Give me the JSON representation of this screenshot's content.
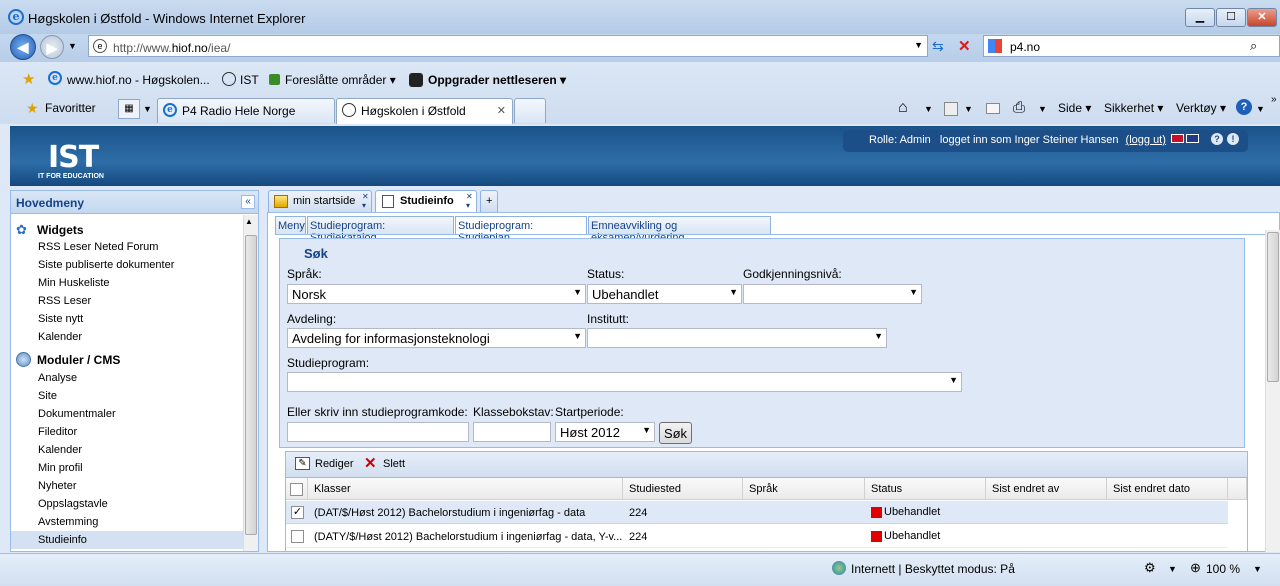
{
  "window": {
    "title": "Høgskolen i Østfold - Windows Internet Explorer",
    "buttons": {
      "minimize": "▁",
      "maximize": "☐",
      "close": "✕"
    }
  },
  "address": {
    "url_prefix": "http://www.",
    "url_domain": "hiof.no",
    "url_suffix": "/iea/",
    "search_value": "p4.no"
  },
  "favbar": {
    "items": [
      "www.hiof.no - Høgskolen...",
      "IST",
      "Foreslåtte områder ▾",
      "Oppgrader nettleseren ▾"
    ]
  },
  "tabs": {
    "favorites": "Favoritter",
    "tab1": "P4 Radio Hele Norge",
    "tab2": "Høgskolen i Østfold"
  },
  "commandbar": {
    "side": "Side ▾",
    "sikkerhet": "Sikkerhet ▾",
    "verktoy": "Verktøy ▾"
  },
  "app": {
    "logo": "IST",
    "logo_sub": "IT FOR EDUCATION",
    "role_text": "Rolle: Admin   logget inn som Inger Steiner Hansen",
    "logout": "(logg ut)"
  },
  "sidebar": {
    "title": "Hovedmeny",
    "collapse": "«",
    "groups": [
      {
        "label": "Widgets",
        "items": [
          "RSS Leser Neted Forum",
          "Siste publiserte dokumenter",
          "Min Huskeliste",
          "RSS Leser",
          "Siste nytt",
          "Kalender"
        ]
      },
      {
        "label": "Moduler / CMS",
        "items": [
          "Analyse",
          "Site",
          "Dokumentmaler",
          "Fileditor",
          "Kalender",
          "Min profil",
          "Nyheter",
          "Oppslagstavle",
          "Avstemming",
          "Studieinfo"
        ]
      }
    ]
  },
  "maintabs": [
    "min startside",
    "Studieinfo",
    "+"
  ],
  "subtabs": [
    "Meny",
    "Studieprogram: Studiekatalog",
    "Studieprogram: Studieplan",
    "Emneavvikling og eksamen/vurdering"
  ],
  "search": {
    "legend": "Søk",
    "sprak_label": "Språk:",
    "sprak_value": "Norsk",
    "status_label": "Status:",
    "status_value": "Ubehandlet",
    "godkj_label": "Godkjenningsnivå:",
    "godkj_value": "",
    "avdeling_label": "Avdeling:",
    "avdeling_value": "Avdeling for informasjonsteknologi",
    "institutt_label": "Institutt:",
    "institutt_value": "",
    "studieprogram_label": "Studieprogram:",
    "studieprogram_value": "",
    "kode_label": "Eller skriv inn studieprogramkode:",
    "klasse_label": "Klassebokstav:",
    "start_label": "Startperiode:",
    "start_value": "Høst 2012",
    "search_button": "Søk"
  },
  "grid": {
    "toolbar": {
      "edit": "Rediger",
      "delete": "Slett"
    },
    "columns": [
      "Klasser",
      "Studiested",
      "Språk",
      "Status",
      "Sist endret av",
      "Sist endret dato"
    ],
    "rows": [
      {
        "checked": "✓",
        "klasse": "(DAT/$/Høst 2012) Bachelorstudium i ingeniørfag - data",
        "studiested": "224",
        "status": "Ubehandlet"
      },
      {
        "checked": "",
        "klasse": "(DATY/$/Høst 2012) Bachelorstudium i ingeniørfag - data, Y-v...",
        "studiested": "224",
        "status": "Ubehandlet"
      }
    ]
  },
  "statusbar": {
    "zone": "Internett | Beskyttet modus: På",
    "zoom": "100 %"
  }
}
